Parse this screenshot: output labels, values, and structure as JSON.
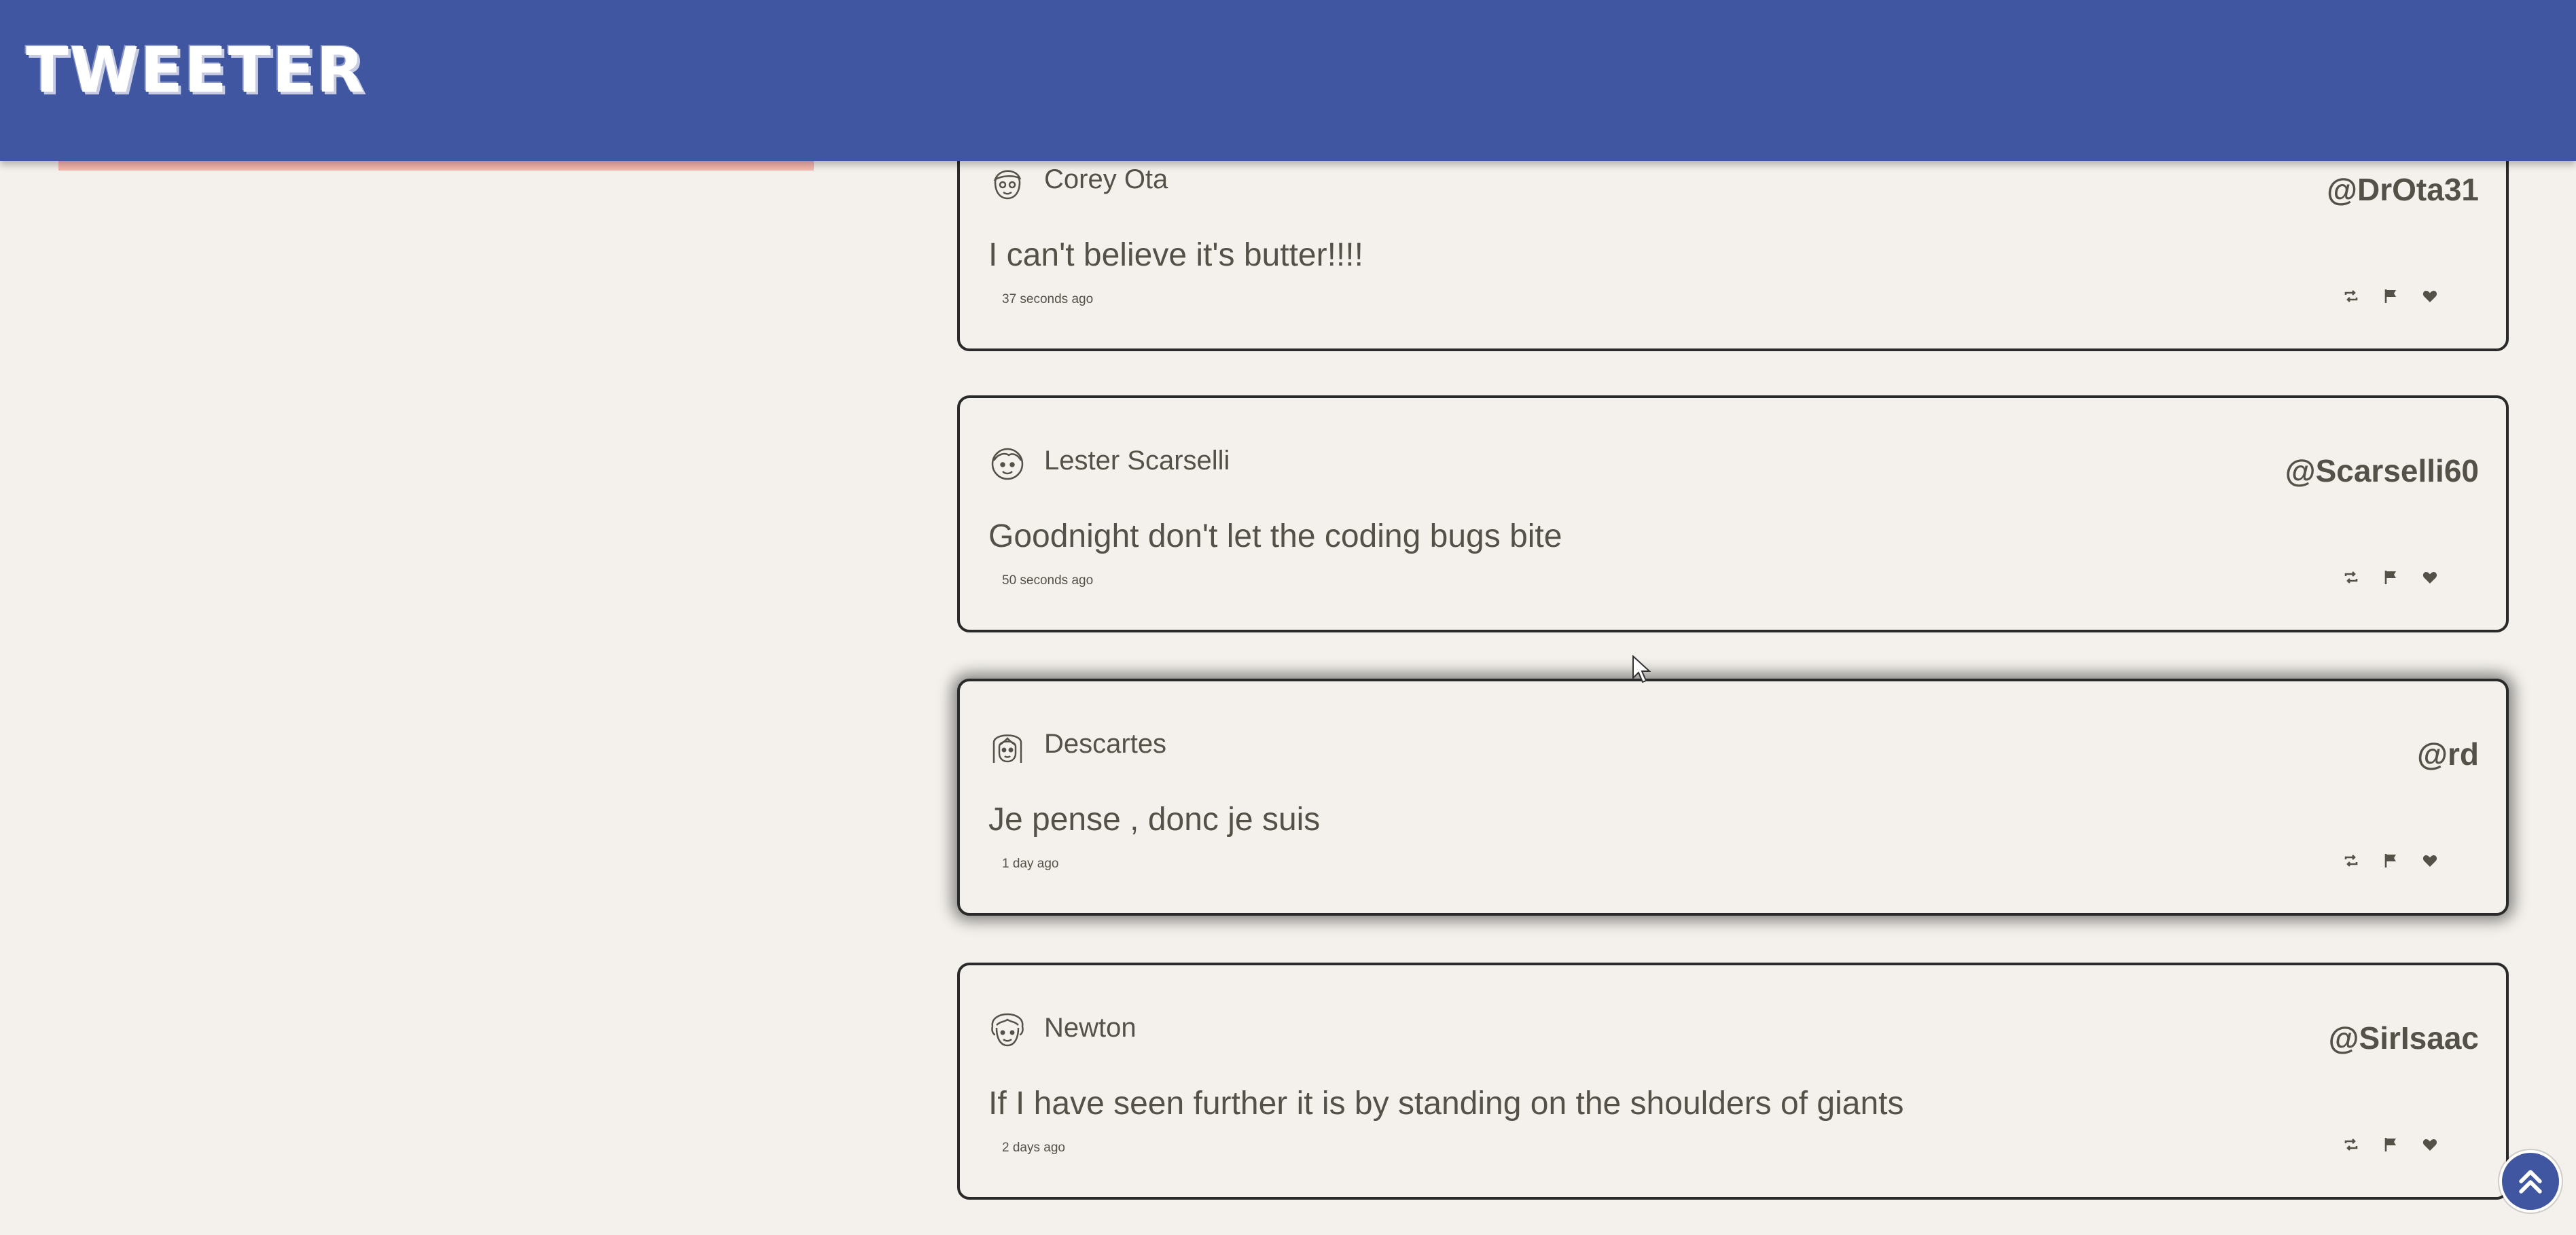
{
  "app": {
    "title": "TWEETER"
  },
  "colors": {
    "header": "#4056a1",
    "background": "#f4f1ec",
    "accent_strip": "#f7b6ad",
    "text": "#545149"
  },
  "tweets": [
    {
      "name": "Corey Ota",
      "handle": "@DrOta31",
      "content": "I can't believe it's butter!!!!",
      "time": "37 seconds ago",
      "avatar_icon": "face-glasses-icon"
    },
    {
      "name": "Lester Scarselli",
      "handle": "@Scarselli60",
      "content": "Goodnight don't let the coding bugs bite",
      "time": "50 seconds ago",
      "avatar_icon": "face-smile-icon"
    },
    {
      "name": "Descartes",
      "handle": "@rd",
      "content": "Je pense , donc je suis",
      "time": "1 day ago",
      "avatar_icon": "face-long-hair-icon"
    },
    {
      "name": "Newton",
      "handle": "@SirIsaac",
      "content": "If I have seen further it is by standing on the shoulders of giants",
      "time": "2 days ago",
      "avatar_icon": "face-curly-hair-icon"
    }
  ],
  "actions": [
    "retweet-icon",
    "flag-icon",
    "heart-icon"
  ],
  "scroll_button_icon": "double-chevron-up-icon"
}
